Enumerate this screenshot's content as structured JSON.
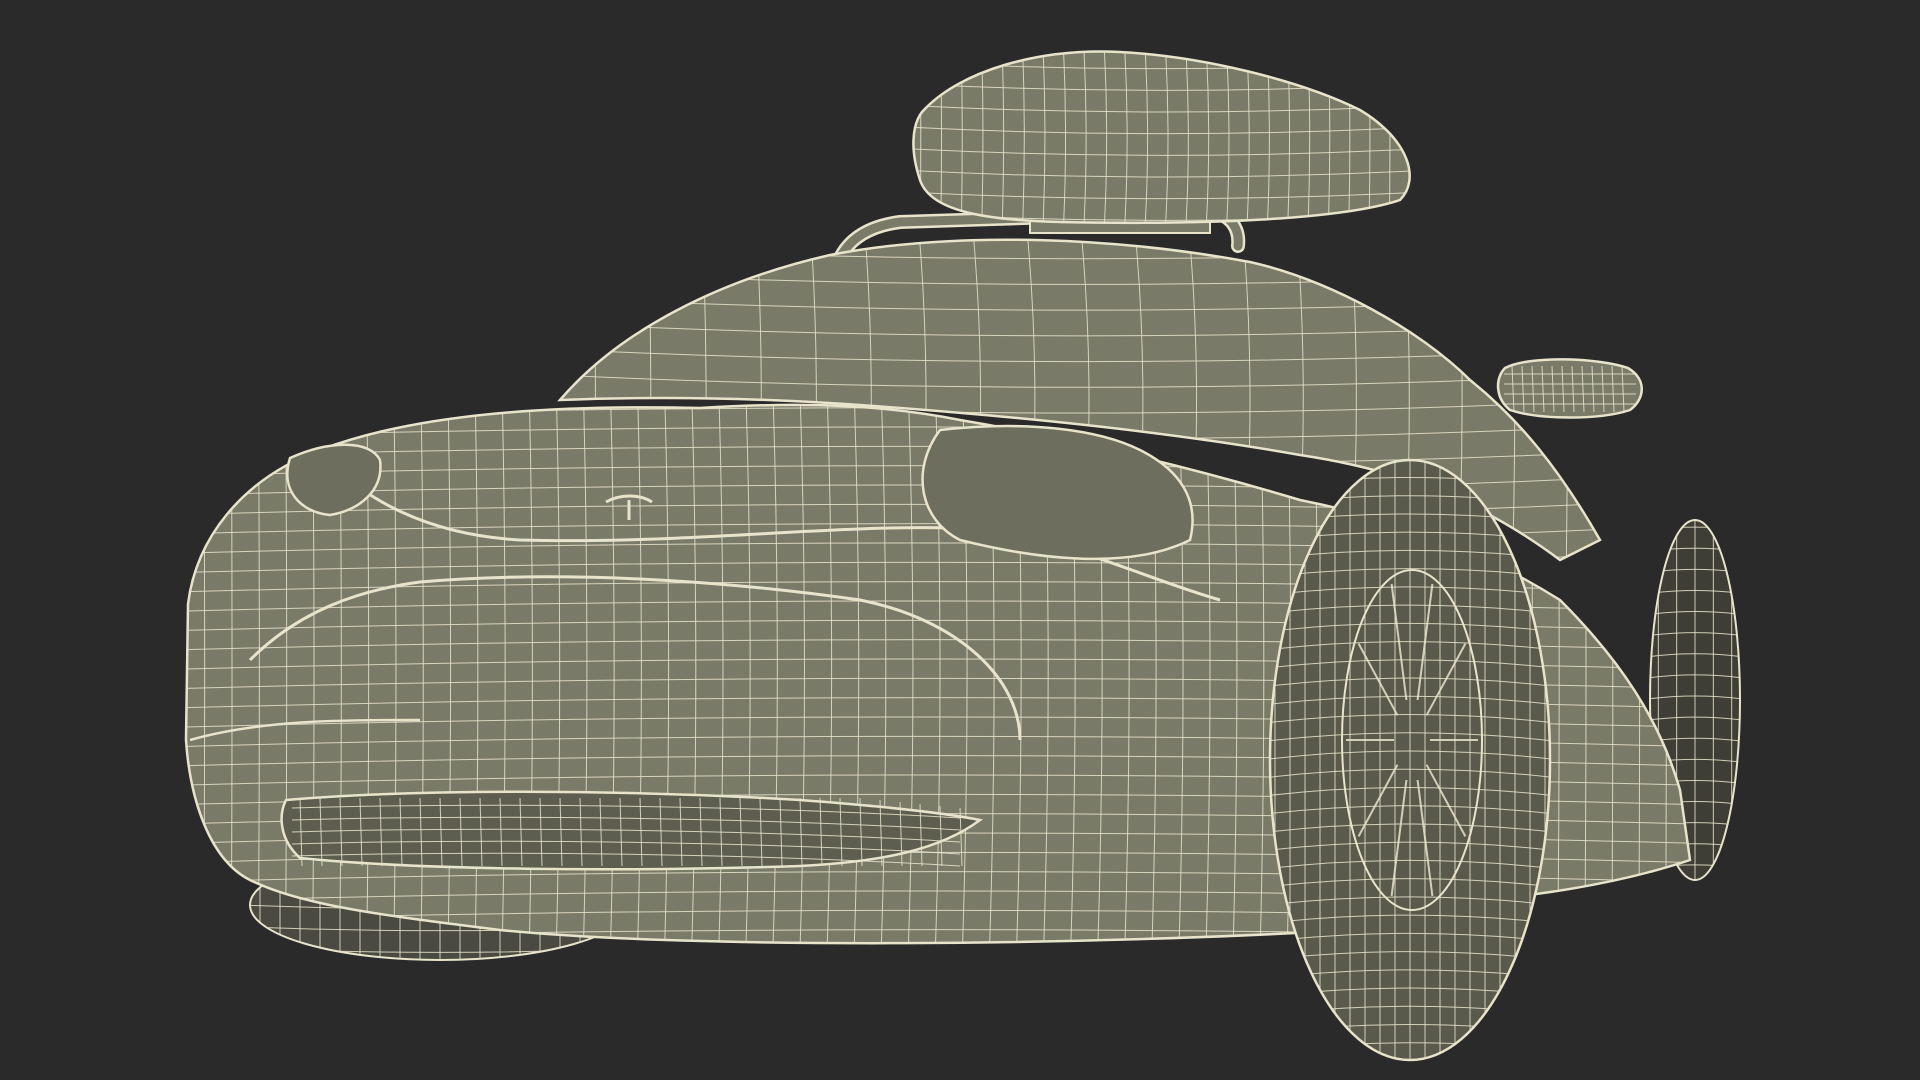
{
  "scene": {
    "subject": "car-wireframe-render",
    "colors": {
      "background": "#2a2a2a",
      "body_fill": "#7a7a68",
      "body_fill_dark": "#5e5e50",
      "shadow_fill": "#3e3e36",
      "wire": "#e8e4cc"
    }
  }
}
